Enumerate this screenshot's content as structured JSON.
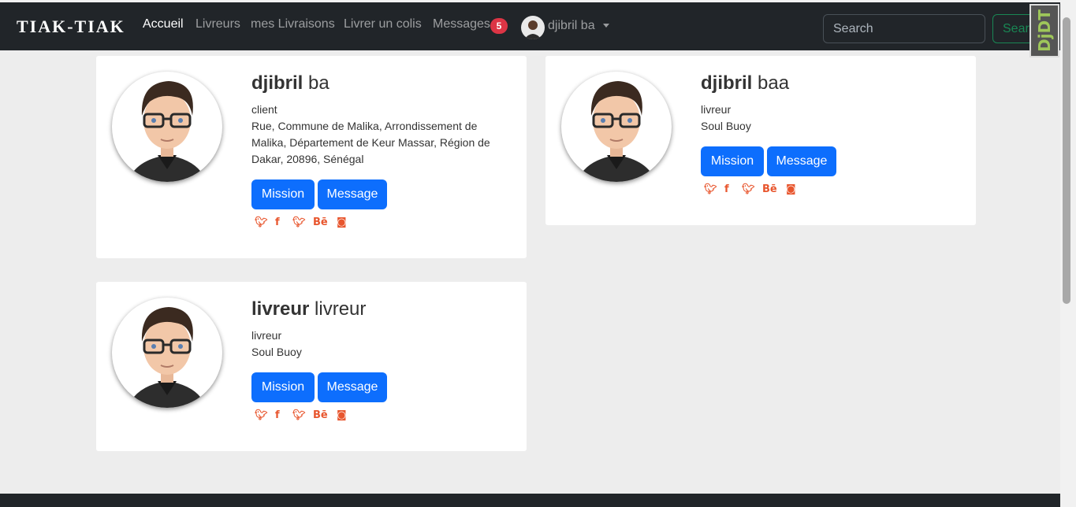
{
  "navbar": {
    "brand": "TIAK-TIAK",
    "links": [
      "Accueil",
      "Livreurs",
      "mes Livraisons",
      "Livrer un colis",
      "Messages"
    ],
    "messages_badge": "5",
    "user_name": "djibril ba",
    "search_placeholder": "Search",
    "search_button": "Search",
    "debug_toolbar": "DjDT"
  },
  "cards": [
    {
      "first_name": "djibril",
      "last_name": "ba",
      "role": "client",
      "address": "Rue, Commune de Malika, Arrondissement de Malika, Département de Keur Massar, Région de Dakar, 20896, Sénégal",
      "mission_label": "Mission",
      "message_label": "Message"
    },
    {
      "first_name": "djibril",
      "last_name": "baa",
      "role": "livreur",
      "address": "Soul Buoy",
      "mission_label": "Mission",
      "message_label": "Message"
    },
    {
      "first_name": "livreur",
      "last_name": "livreur",
      "role": "livreur",
      "address": "Soul Buoy",
      "mission_label": "Mission",
      "message_label": "Message"
    }
  ],
  "social_icons": [
    "twitter-icon",
    "facebook-icon",
    "twitter-icon",
    "behance-icon",
    "instagram-icon"
  ],
  "colors": {
    "accent": "#0d6efd",
    "social": "#e8562e",
    "navbar": "#212529",
    "badge": "#dc3545"
  }
}
